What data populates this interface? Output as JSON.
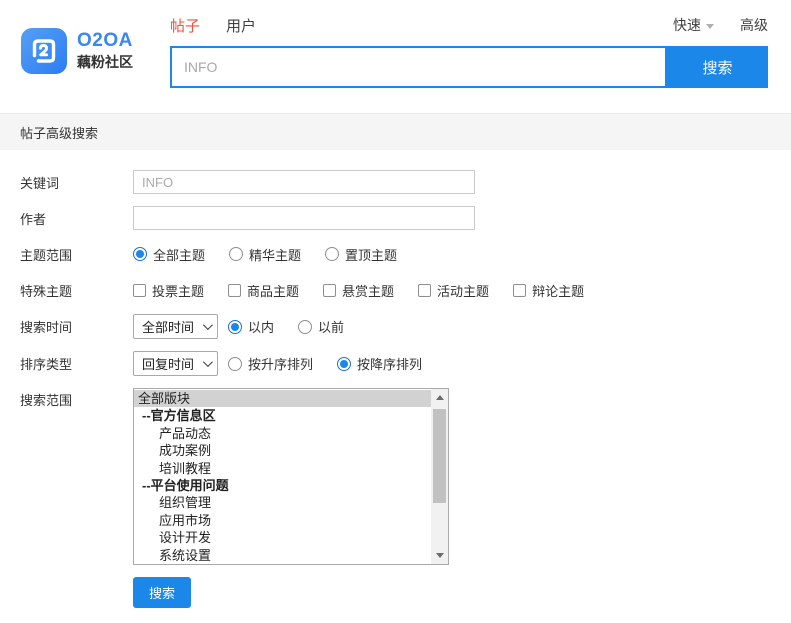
{
  "header": {
    "logo": {
      "brand": "O2OA",
      "community": "藕粉社区"
    },
    "tabs": [
      {
        "label": "帖子",
        "active": true
      },
      {
        "label": "用户",
        "active": false
      }
    ],
    "quick_label": "快速",
    "advanced_label": "高级",
    "search": {
      "placeholder": "INFO",
      "button_label": "搜索"
    }
  },
  "section_title": "帖子高级搜索",
  "form": {
    "keyword": {
      "label": "关键词",
      "placeholder": "INFO"
    },
    "author": {
      "label": "作者",
      "value": ""
    },
    "topic_scope": {
      "label": "主题范围",
      "options": [
        {
          "label": "全部主题",
          "selected": true
        },
        {
          "label": "精华主题",
          "selected": false
        },
        {
          "label": "置顶主题",
          "selected": false
        }
      ]
    },
    "special_topics": {
      "label": "特殊主题",
      "options": [
        {
          "label": "投票主题",
          "checked": false
        },
        {
          "label": "商品主题",
          "checked": false
        },
        {
          "label": "悬赏主题",
          "checked": false
        },
        {
          "label": "活动主题",
          "checked": false
        },
        {
          "label": "辩论主题",
          "checked": false
        }
      ]
    },
    "search_time": {
      "label": "搜索时间",
      "select_value": "全部时间",
      "options": [
        {
          "label": "以内",
          "selected": true
        },
        {
          "label": "以前",
          "selected": false
        }
      ]
    },
    "sort_type": {
      "label": "排序类型",
      "select_value": "回复时间",
      "options": [
        {
          "label": "按升序排列",
          "selected": false
        },
        {
          "label": "按降序排列",
          "selected": true
        }
      ]
    },
    "search_scope": {
      "label": "搜索范围",
      "items": [
        {
          "label": "全部版块",
          "type": "root",
          "selected": true
        },
        {
          "label": "--官方信息区",
          "type": "group",
          "selected": false
        },
        {
          "label": "产品动态",
          "type": "child",
          "selected": false
        },
        {
          "label": "成功案例",
          "type": "child",
          "selected": false
        },
        {
          "label": "培训教程",
          "type": "child",
          "selected": false
        },
        {
          "label": "--平台使用问题",
          "type": "group",
          "selected": false
        },
        {
          "label": "组织管理",
          "type": "child",
          "selected": false
        },
        {
          "label": "应用市场",
          "type": "child",
          "selected": false
        },
        {
          "label": "设计开发",
          "type": "child",
          "selected": false
        },
        {
          "label": "系统设置",
          "type": "child",
          "selected": false
        }
      ]
    },
    "submit_label": "搜索"
  },
  "colors": {
    "accent_blue": "#1b87e9",
    "accent_red": "#f0503c",
    "logo_blue_start": "#55a0f5",
    "logo_blue_end": "#2b7cf3",
    "section_bar_bg": "#f5f5f5",
    "list_selected_bg": "#d2d2d2"
  },
  "icons": {
    "caret_down": "▾",
    "select_chevron": "∨",
    "scroll_up": "▲",
    "scroll_down": "▼"
  }
}
